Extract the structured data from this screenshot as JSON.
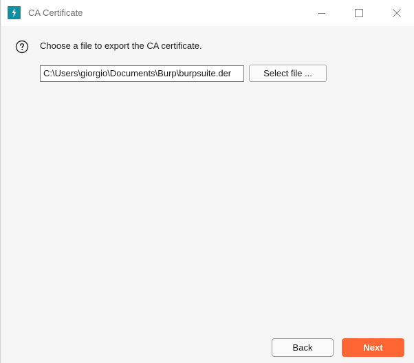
{
  "window": {
    "title": "CA Certificate",
    "app_icon": "burp-lightning-icon",
    "controls": {
      "minimize": "minimize-icon",
      "maximize": "maximize-icon",
      "close": "close-icon"
    }
  },
  "main": {
    "help_icon": "question-mark-icon",
    "instruction": "Choose a file to export the CA certificate.",
    "file_path_value": "C:\\Users\\giorgio\\Documents\\Burp\\burpsuite.der",
    "select_file_label": "Select file ..."
  },
  "footer": {
    "back_label": "Back",
    "next_label": "Next"
  },
  "colors": {
    "accent": "#ff6633",
    "app_icon_bg": "#0f8fa3",
    "content_bg": "#f5f5f5"
  }
}
